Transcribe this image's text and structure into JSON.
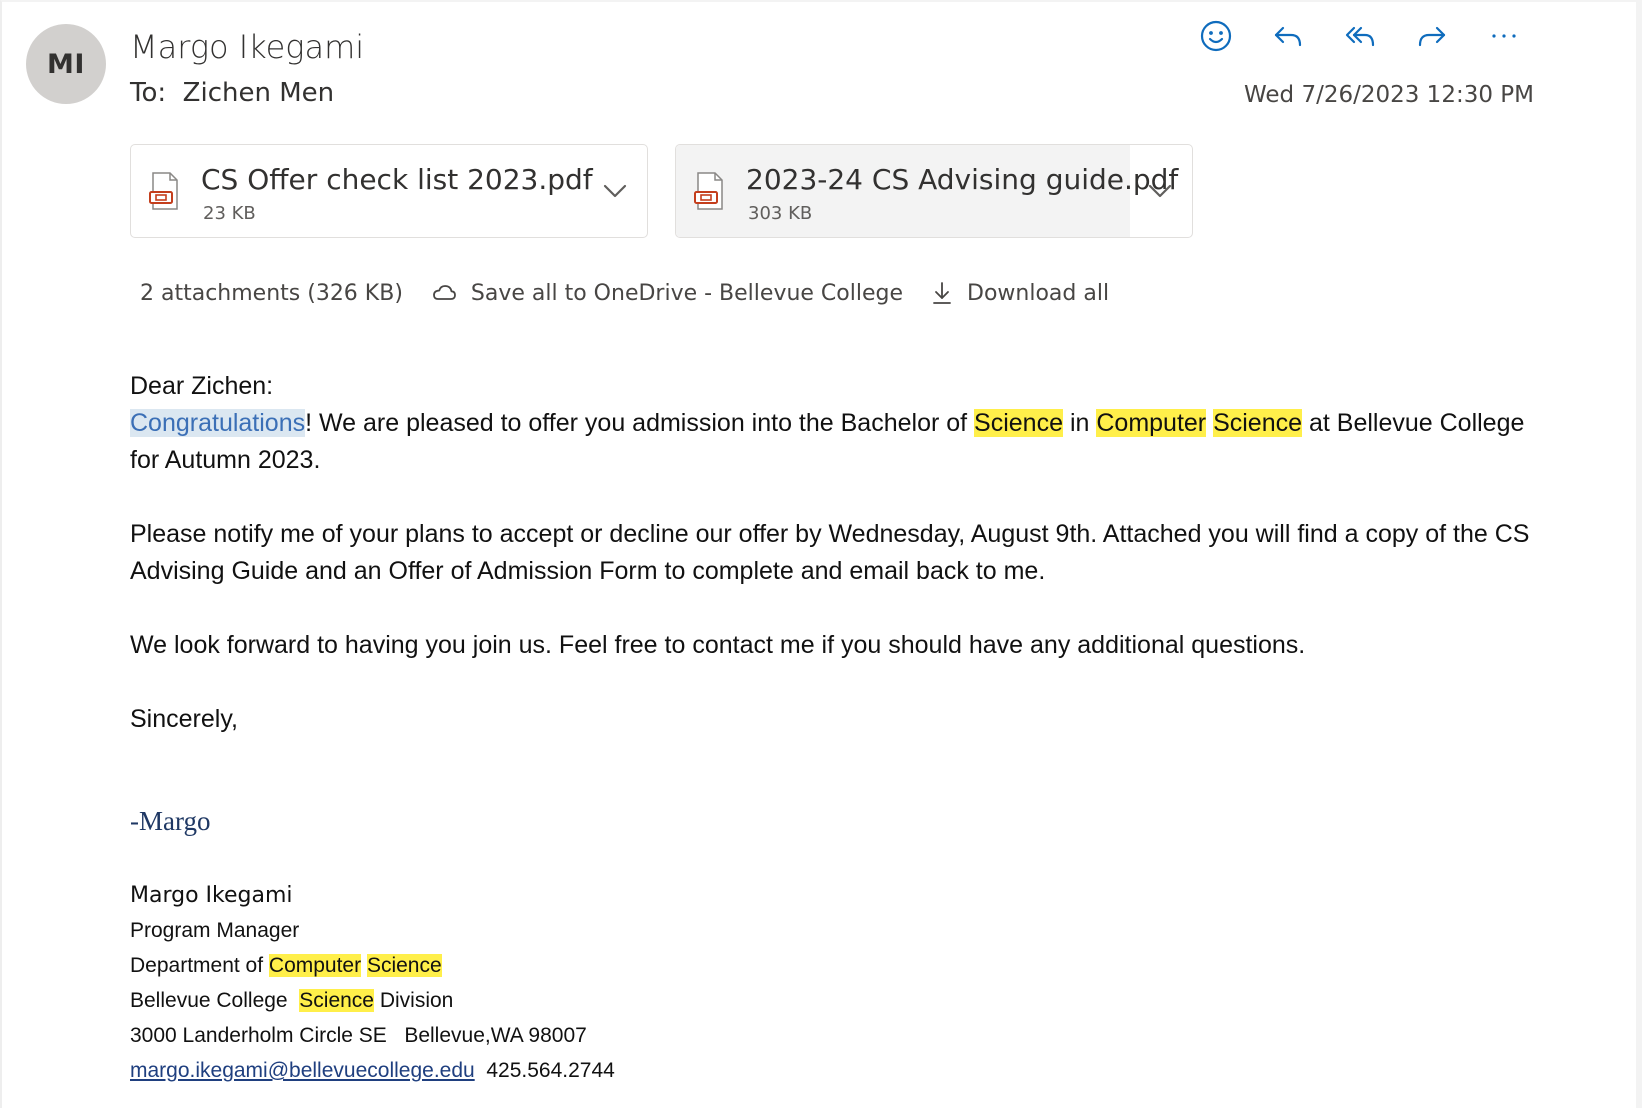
{
  "header": {
    "avatar_initials": "MI",
    "sender_name": "Margo Ikegami",
    "to_label": "To:",
    "to_name": "Zichen Men",
    "date": "Wed 7/26/2023 12:30 PM",
    "actions": [
      "smiley-icon",
      "reply-icon",
      "reply-all-icon",
      "forward-icon",
      "more-icon"
    ]
  },
  "attachments": [
    {
      "name": "CS Offer check list 2023.pdf",
      "size": "23 KB",
      "icon": "pdf-file-icon"
    },
    {
      "name": "2023-24 CS Advising guide.pdf",
      "size": "303 KB",
      "icon": "pdf-file-icon"
    }
  ],
  "attachment_bar": {
    "summary": "2 attachments (326 KB)",
    "save_all": "Save all to OneDrive - Bellevue College",
    "download_all": "Download all"
  },
  "body": {
    "greeting": "Dear Zichen:",
    "p1": {
      "congrats": "Congratulations",
      "t1": "!  We are pleased to offer you admission into the Bachelor of ",
      "w_science1": "Science",
      "t2": " in ",
      "w_computer": "Computer",
      "w_science2": "Science",
      "t3": " at Bellevue College for Autumn 2023."
    },
    "p2": "Please notify me of your plans to accept or decline our offer by Wednesday, August 9th.   Attached you will find a copy of the CS Advising Guide and an Offer of Admission Form to complete and email back to me.",
    "p3": "We look forward to having you join us.  Feel free to contact me if you should have any additional questions.",
    "closing": "Sincerely,"
  },
  "signature": {
    "handwritten": "-Margo",
    "name": "Margo Ikegami",
    "title": "Program Manager",
    "dept_prefix": "Department of ",
    "dept_computer": "Computer",
    "dept_science": "Science",
    "college": "Bellevue College  ",
    "division_science": "Science",
    "division_suffix": " Division",
    "address": "3000 Landerholm Circle SE   Bellevue,WA 98007",
    "email": "margo.ikegami@bellevuecollege.edu",
    "phone": "425.564.2744"
  },
  "colors": {
    "accent": "#0f6cbd",
    "highlight": "#ffef4a",
    "selection": "#dbe7f1",
    "avatar_bg": "#d2d0ce"
  }
}
